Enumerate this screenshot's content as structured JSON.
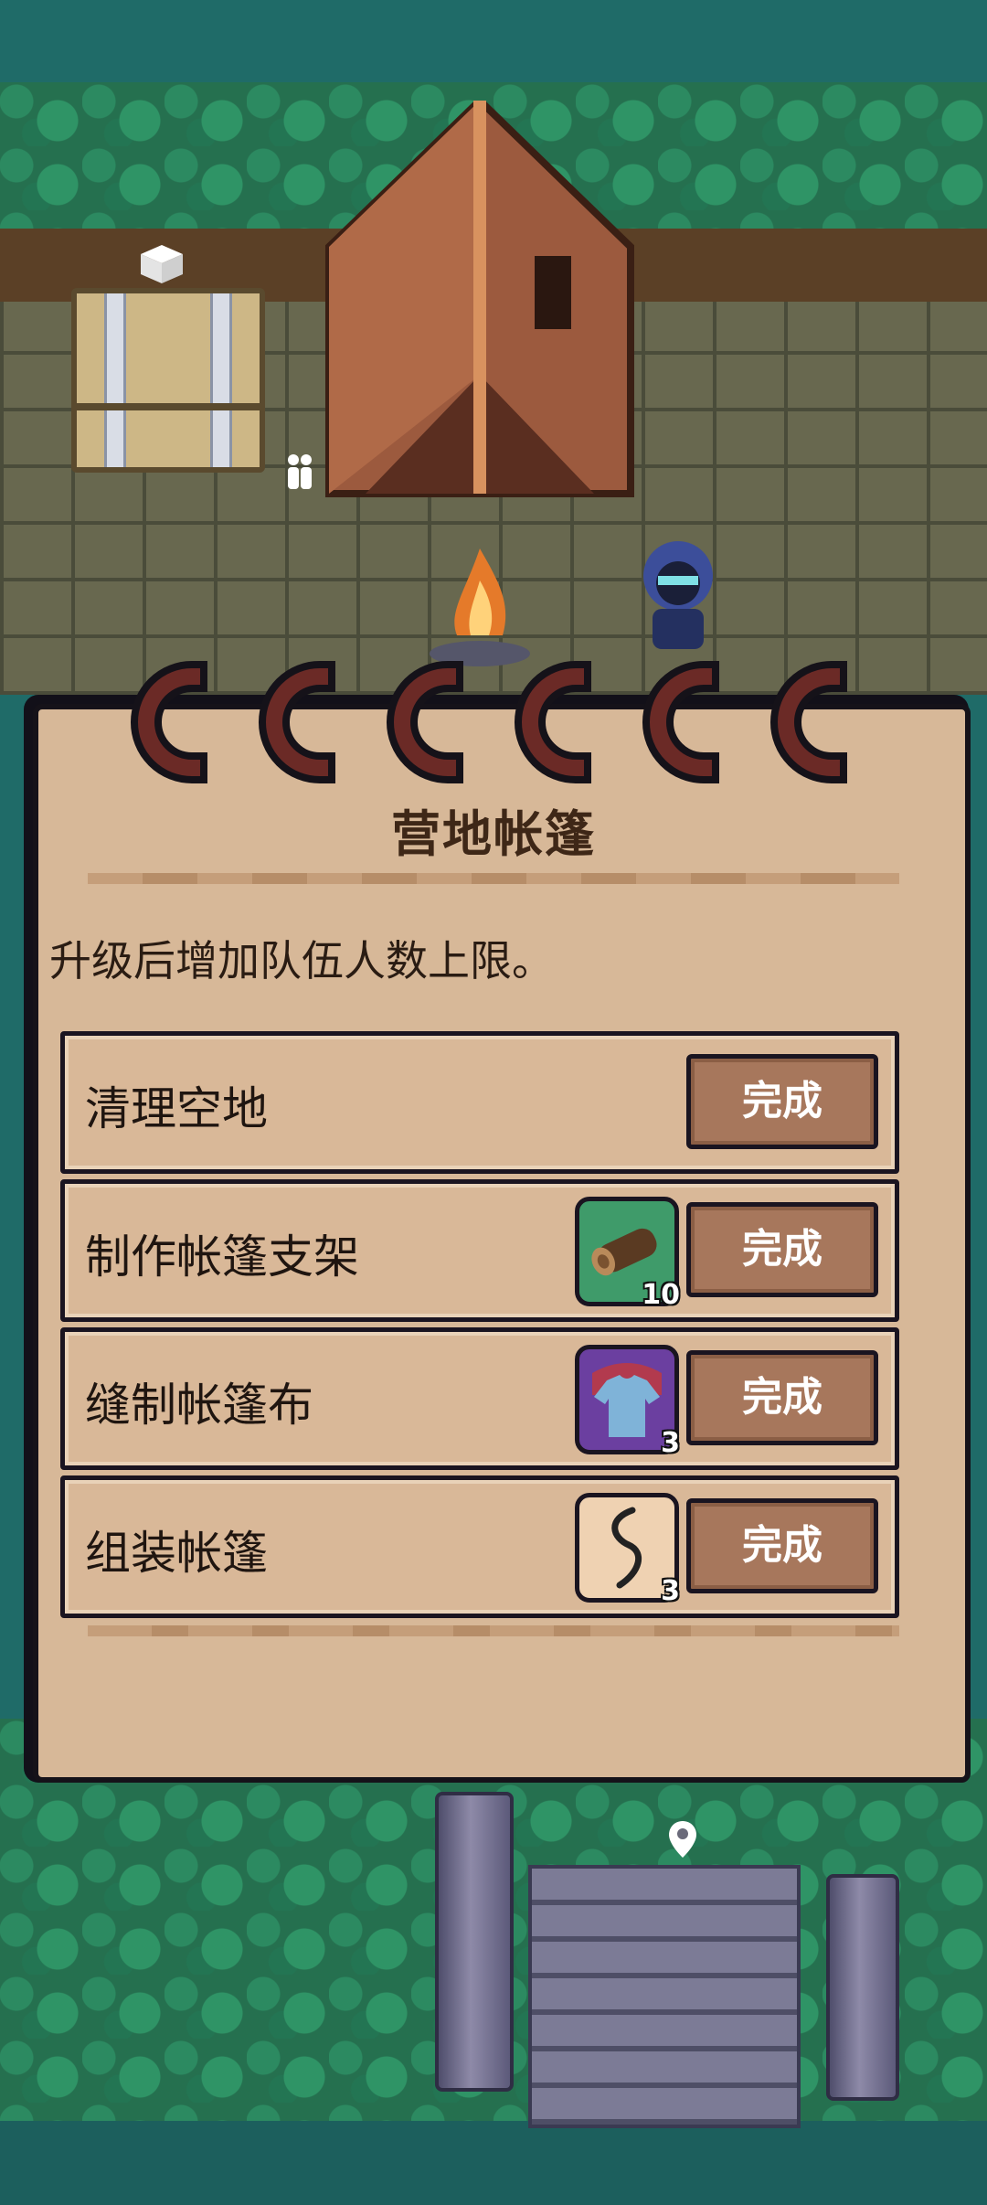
{
  "panel": {
    "title": "营地帐篷",
    "description": "升级后增加队伍人数上限。"
  },
  "tasks": [
    {
      "label": "清理空地",
      "button": "完成",
      "icon": null,
      "count": null
    },
    {
      "label": "制作帐篷支架",
      "button": "完成",
      "icon": "wood-log-icon",
      "count": "10"
    },
    {
      "label": "缝制帐篷布",
      "button": "完成",
      "icon": "cloth-shirt-icon",
      "count": "3"
    },
    {
      "label": "组装帐篷",
      "button": "完成",
      "icon": "rope-icon",
      "count": "3"
    }
  ],
  "colors": {
    "panel_bg": "#d7b898",
    "button_bg": "#a7775c",
    "frame": "#151219",
    "forest": "#1f6b68"
  }
}
